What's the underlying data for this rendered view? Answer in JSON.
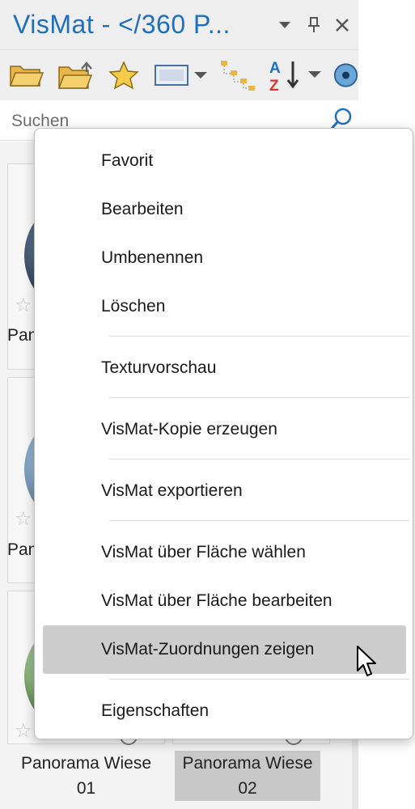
{
  "window": {
    "title": "VisMat - </360 P...",
    "dropdown_icon": "dropdown-arrow-icon",
    "pin_icon": "pin-icon",
    "close_icon": "close-icon"
  },
  "toolbar": {
    "tools": [
      "folder-open-icon",
      "folder-up-icon",
      "favorite-star-icon",
      "view-mode-icon",
      "tree-view-icon",
      "sort-az-icon",
      "material-sphere-icon"
    ]
  },
  "search": {
    "placeholder": "Suchen",
    "value": ""
  },
  "thumbnails": [
    {
      "caption_line1": "Pan",
      "caption_line2": ""
    },
    {
      "caption_line1": "Pan",
      "caption_line2": ""
    },
    {
      "caption_line1": "Panorama Wiese",
      "caption_line2": "01"
    },
    {
      "caption_line1": "Panorama Wiese",
      "caption_line2": "02",
      "selected": true
    }
  ],
  "context_menu": {
    "items": [
      {
        "label": "Favorit"
      },
      {
        "label": "Bearbeiten"
      },
      {
        "label": "Umbenennen"
      },
      {
        "label": "Löschen"
      },
      {
        "label": "Texturvorschau"
      },
      {
        "label": "VisMat-Kopie erzeugen"
      },
      {
        "label": "VisMat exportieren"
      },
      {
        "label": "VisMat über Fläche wählen"
      },
      {
        "label": "VisMat über Fläche bearbeiten"
      },
      {
        "label": "VisMat-Zuordnungen zeigen",
        "hovered": true
      },
      {
        "label": "Eigenschaften"
      }
    ]
  },
  "colors": {
    "title": "#1f6fbf",
    "hover": "#cdcdcd",
    "accent_sort_a": "#1f6fbf",
    "accent_sort_z": "#d9342b"
  }
}
